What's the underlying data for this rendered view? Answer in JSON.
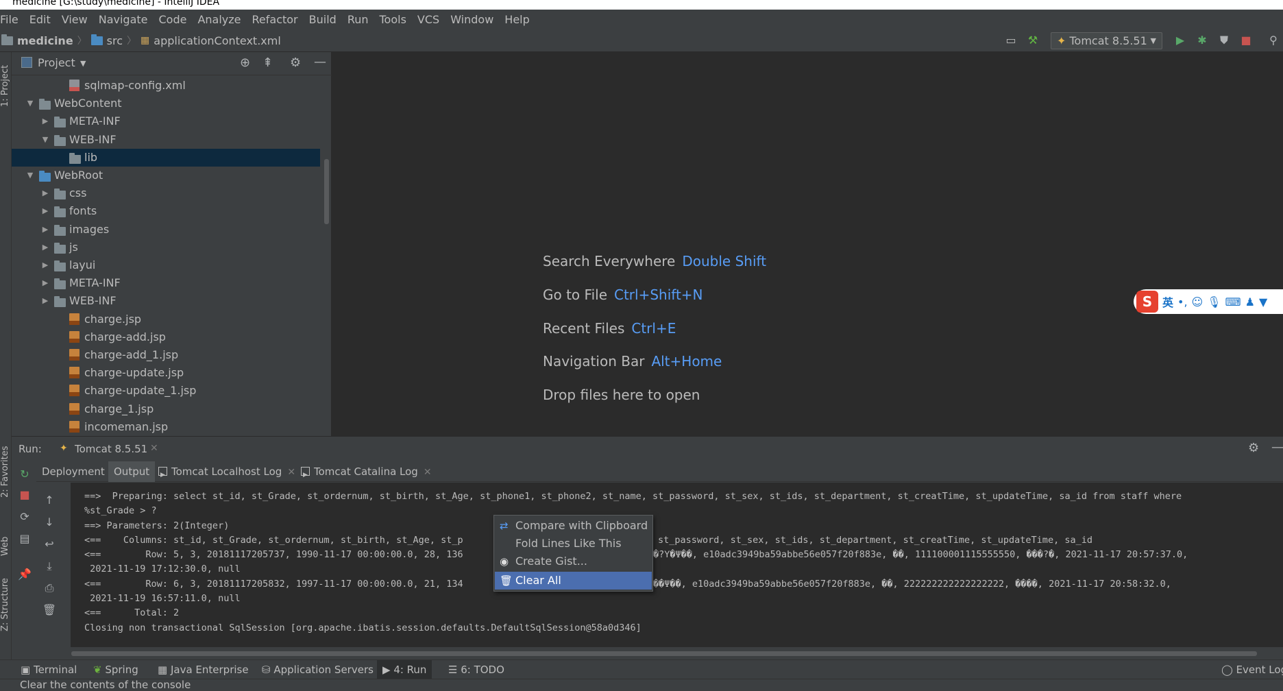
{
  "window": {
    "title": "medicine [G:\\study\\medicine] - IntelliJ IDEA"
  },
  "menu": [
    "File",
    "Edit",
    "View",
    "Navigate",
    "Code",
    "Analyze",
    "Refactor",
    "Build",
    "Run",
    "Tools",
    "VCS",
    "Window",
    "Help"
  ],
  "breadcrumb": {
    "project": "medicine",
    "folder": "src",
    "file": "applicationContext.xml"
  },
  "toolbar": {
    "run_config": "Tomcat 8.5.51"
  },
  "project_panel": {
    "title": "Project",
    "tree": [
      {
        "label": "sqlmap-config.xml",
        "type": "xml",
        "expanded": null
      },
      {
        "label": "WebContent",
        "type": "folder",
        "expanded": true
      },
      {
        "label": "META-INF",
        "type": "folder",
        "expanded": false
      },
      {
        "label": "WEB-INF",
        "type": "folder",
        "expanded": true
      },
      {
        "label": "lib",
        "type": "folder",
        "expanded": null,
        "selected": true
      },
      {
        "label": "WebRoot",
        "type": "webfolder",
        "expanded": true
      },
      {
        "label": "css",
        "type": "folder",
        "expanded": false
      },
      {
        "label": "fonts",
        "type": "folder",
        "expanded": false
      },
      {
        "label": "images",
        "type": "folder",
        "expanded": false
      },
      {
        "label": "js",
        "type": "folder",
        "expanded": false
      },
      {
        "label": "layui",
        "type": "folder",
        "expanded": false
      },
      {
        "label": "META-INF",
        "type": "folder",
        "expanded": false
      },
      {
        "label": "WEB-INF",
        "type": "folder",
        "expanded": false
      },
      {
        "label": "charge.jsp",
        "type": "jsp",
        "expanded": null
      },
      {
        "label": "charge-add.jsp",
        "type": "jsp",
        "expanded": null
      },
      {
        "label": "charge-add_1.jsp",
        "type": "jsp",
        "expanded": null
      },
      {
        "label": "charge-update.jsp",
        "type": "jsp",
        "expanded": null
      },
      {
        "label": "charge-update_1.jsp",
        "type": "jsp",
        "expanded": null
      },
      {
        "label": "charge_1.jsp",
        "type": "jsp",
        "expanded": null
      },
      {
        "label": "incomeman.jsp",
        "type": "jsp",
        "expanded": null
      }
    ]
  },
  "welcome": [
    {
      "label": "Search Everywhere",
      "shortcut": "Double Shift"
    },
    {
      "label": "Go to File",
      "shortcut": "Ctrl+Shift+N"
    },
    {
      "label": "Recent Files",
      "shortcut": "Ctrl+E"
    },
    {
      "label": "Navigation Bar",
      "shortcut": "Alt+Home"
    },
    {
      "label": "Drop files here to open",
      "shortcut": ""
    }
  ],
  "ime": {
    "logo": "S",
    "mode": "英",
    "punct": "•,"
  },
  "run_panel": {
    "label": "Run:",
    "config_tab": "Tomcat 8.5.51",
    "tabs": [
      "Deployment",
      "Output",
      "Tomcat Localhost Log",
      "Tomcat Catalina Log"
    ],
    "console": [
      "==>  Preparing: select st_id, st_Grade, st_ordernum, st_birth, st_Age, st_phone1, st_phone2, st_name, st_password, st_sex, st_ids, st_department, st_creatTime, st_updateTime, sa_id from staff where",
      "%st_Grade > ?",
      "==> Parameters: 2(Integer)",
      "<==    Columns: st_id, st_Grade, st_ordernum, st_birth, st_Age, st_p",
      "<==        Row: 5, 3, 20181117205737, 1990-11-17 00:00:00.0, 28, 136",
      " 2021-11-19 17:12:30.0, null",
      "<==        Row: 6, 3, 20181117205832, 1997-11-17 00:00:00.0, 21, 134",
      " 2021-11-19 16:57:11.0, null",
      "<==      Total: 2",
      "Closing non transactional SqlSession [org.apache.ibatis.session.defaults.DefaultSqlSession@58a0d346]"
    ],
    "console_right": [
      "st_password, st_sex, st_ids, st_department, st_creatTime, st_updateTime, sa_id",
      "�?Υ�Ψ��, e10adc3949ba59abbe56e057f20f883e, ��, 111100001115555550, ���?�, 2021-11-17 20:57:37.0,",
      "��Ψ��, e10adc3949ba59abbe56e057f20f883e, ��, 222222222222222222, ����, 2021-11-17 20:58:32.0,"
    ]
  },
  "context_menu": [
    {
      "label": "Compare with Clipboard",
      "icon": "compare-icon"
    },
    {
      "label": "Fold Lines Like This",
      "icon": ""
    },
    {
      "label": "Create Gist...",
      "icon": "github-icon"
    },
    {
      "label": "Clear All",
      "icon": "trash-icon"
    }
  ],
  "bottom_tools": [
    "Terminal",
    "Spring",
    "Java Enterprise",
    "Application Servers",
    "4: Run",
    "6: TODO",
    "Event Log"
  ],
  "side_tools": {
    "project": "1: Project",
    "favorites": "2: Favorites",
    "web": "Web",
    "structure": "Z: Structure"
  },
  "status": "Clear the contents of the console",
  "colors": {
    "background": "#2b2b2b",
    "panel": "#3c3f41",
    "shortcut": "#589df6",
    "selection": "#4b6eaf"
  }
}
